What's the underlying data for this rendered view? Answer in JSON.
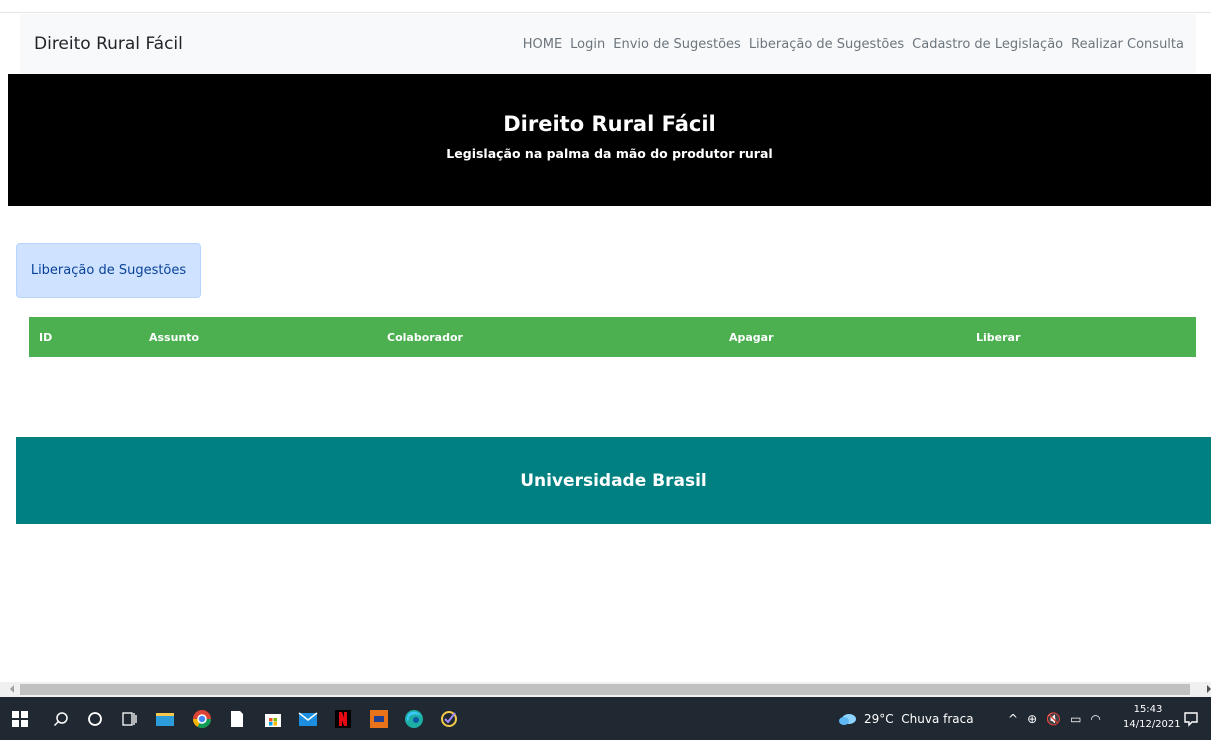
{
  "navbar": {
    "brand": "Direito Rural Fácil",
    "links": [
      "HOME",
      "Login",
      "Envio de Sugestões",
      "Liberação de Sugestões",
      "Cadastro de Legislação",
      "Realizar Consulta"
    ]
  },
  "hero": {
    "title": "Direito Rural Fácil",
    "subtitle": "Legislação na palma da mão do produtor rural"
  },
  "section": {
    "title": "Liberação de Sugestões"
  },
  "table": {
    "headers": [
      "ID",
      "Assunto",
      "Colaborador",
      "Apagar",
      "Liberar"
    ],
    "rows": []
  },
  "footer": {
    "text": "Universidade Brasil"
  },
  "taskbar": {
    "weather": "29°C  Chuva fraca",
    "time": "15:43",
    "date": "14/12/2021"
  },
  "colors": {
    "table_header": "#4caf50",
    "footer": "#008080",
    "hero": "#000000",
    "section_title_bg": "#cfe2ff"
  }
}
